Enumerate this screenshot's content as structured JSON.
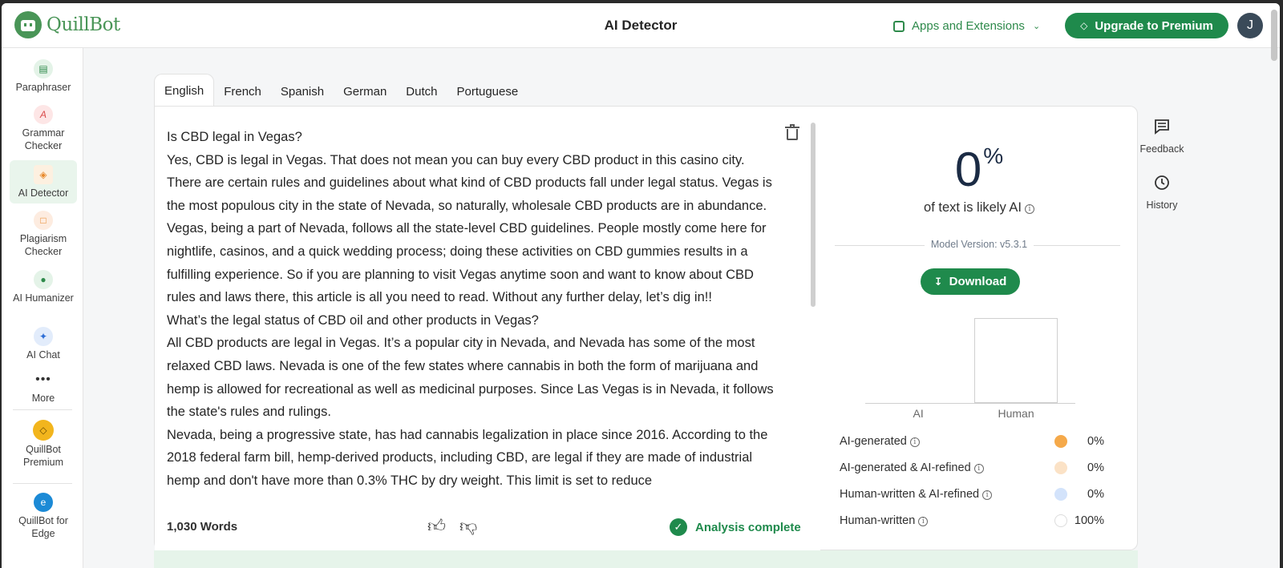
{
  "header": {
    "logo_text": "QuillBot",
    "page_title": "AI Detector",
    "apps_label": "Apps and Extensions",
    "premium_label": "Upgrade to Premium",
    "avatar_initial": "J"
  },
  "sidebar": {
    "items": [
      {
        "label": "Paraphraser"
      },
      {
        "label": "Grammar Checker"
      },
      {
        "label": "AI Detector"
      },
      {
        "label": "Plagiarism Checker"
      },
      {
        "label": "AI Humanizer"
      },
      {
        "label": "AI Chat"
      },
      {
        "label": "More"
      },
      {
        "label": "QuillBot Premium"
      },
      {
        "label": "QuillBot for Edge"
      }
    ]
  },
  "tabs": [
    "English",
    "French",
    "Spanish",
    "German",
    "Dutch",
    "Portuguese"
  ],
  "editor": {
    "paragraphs": [
      "Is CBD legal in Vegas?",
      "Yes, CBD is legal in Vegas. That does not mean you can buy every CBD product in this casino city. There are certain rules and guidelines about what kind of CBD products fall under legal status. Vegas is the most populous city in the state of Nevada, so naturally, wholesale CBD products are in abundance. Vegas, being a part of Nevada, follows all the state-level CBD guidelines. People mostly come here for nightlife, casinos, and a quick wedding process; doing these activities on CBD gummies results in a fulfilling experience. So if you are planning to visit Vegas anytime soon and want to know about CBD rules and laws there, this article is all you need to read. Without any further delay, let’s dig in!!",
      "What’s the legal status of CBD oil and other products in Vegas?",
      "All CBD products are legal in Vegas. It’s a popular city in Nevada, and Nevada has some of the most relaxed CBD laws. Nevada is one of the few states where cannabis in both the form of marijuana and hemp is allowed for recreational as well as medicinal purposes. Since Las Vegas is in Nevada, it follows the state's rules and rulings.",
      "Nevada, being a progressive state, has had cannabis legalization in place since 2016. According to the 2018 federal farm bill, hemp-derived products, including CBD, are legal if they are made of industrial hemp and don't have more than 0.3% THC by dry weight. This limit is set to reduce"
    ],
    "word_count": "1,030 Words",
    "status": "Analysis complete"
  },
  "results": {
    "ai_percent": "0",
    "percent_symbol": "%",
    "likely_label": "of text is likely AI",
    "model_version": "Model Version: v5.3.1",
    "download_label": "Download",
    "chart_data": {
      "type": "bar",
      "categories": [
        "AI",
        "Human"
      ],
      "values": [
        0,
        100
      ],
      "ylim": [
        0,
        100
      ]
    },
    "legend": [
      {
        "label": "AI-generated",
        "percent": "0%",
        "color": "#f5a94a"
      },
      {
        "label": "AI-generated & AI-refined",
        "percent": "0%",
        "color": "#fbe2c6"
      },
      {
        "label": "Human-written & AI-refined",
        "percent": "0%",
        "color": "#d3e3fb"
      },
      {
        "label": "Human-written",
        "percent": "100%",
        "color": "#ffffff"
      }
    ]
  },
  "tools": {
    "feedback": "Feedback",
    "history": "History"
  },
  "colors": {
    "brand_green": "#1f8a4c",
    "logo_green": "#499557"
  }
}
